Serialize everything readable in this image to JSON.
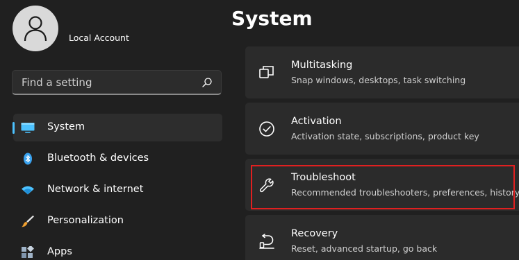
{
  "account": {
    "name": "Local Account",
    "avatar_icon": "person-icon"
  },
  "search": {
    "placeholder": "Find a setting",
    "value": "",
    "icon": "search-icon"
  },
  "sidebar": {
    "accent_color": "#4cc2ff",
    "items": [
      {
        "label": "System",
        "icon": "monitor-icon",
        "active": true
      },
      {
        "label": "Bluetooth & devices",
        "icon": "bluetooth-icon",
        "active": false
      },
      {
        "label": "Network & internet",
        "icon": "wifi-icon",
        "active": false
      },
      {
        "label": "Personalization",
        "icon": "brush-icon",
        "active": false
      },
      {
        "label": "Apps",
        "icon": "apps-icon",
        "active": false
      }
    ]
  },
  "main": {
    "title": "System",
    "highlight_color": "#e02020",
    "cards": [
      {
        "title": "Multitasking",
        "description": "Snap windows, desktops, task switching",
        "icon": "multitasking-icon"
      },
      {
        "title": "Activation",
        "description": "Activation state, subscriptions, product key",
        "icon": "check-circle-icon"
      },
      {
        "title": "Troubleshoot",
        "description": "Recommended troubleshooters, preferences, history",
        "icon": "wrench-icon",
        "highlighted": true
      },
      {
        "title": "Recovery",
        "description": "Reset, advanced startup, go back",
        "icon": "recovery-icon"
      }
    ]
  }
}
